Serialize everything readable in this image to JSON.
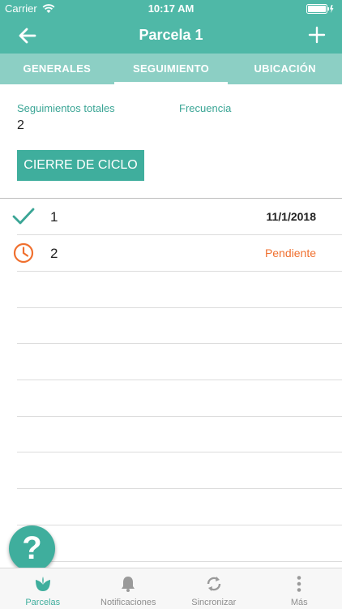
{
  "status_bar": {
    "carrier": "Carrier",
    "time": "10:17 AM"
  },
  "nav": {
    "title": "Parcela 1",
    "back_icon": "arrow-left-icon",
    "add_icon": "plus-icon"
  },
  "tabs": [
    {
      "label": "GENERALES",
      "active": false
    },
    {
      "label": "SEGUIMIENTO",
      "active": true
    },
    {
      "label": "UBICACIÓN",
      "active": false
    }
  ],
  "summary": {
    "total_label": "Seguimientos totales",
    "total_value": "2",
    "frequency_label": "Frecuencia",
    "frequency_value": ""
  },
  "close_cycle_button": "CIERRE DE CICLO",
  "list": [
    {
      "number": "1",
      "status_text": "11/1/2018",
      "icon": "check-icon"
    },
    {
      "number": "2",
      "status_text": "Pendiente",
      "icon": "clock-icon"
    }
  ],
  "help_button": "?",
  "tab_bar": [
    {
      "label": "Parcelas",
      "icon": "leaf-icon",
      "active": true
    },
    {
      "label": "Notificaciones",
      "icon": "bell-icon",
      "active": false
    },
    {
      "label": "Sincronizar",
      "icon": "sync-icon",
      "active": false
    },
    {
      "label": "Más",
      "icon": "more-icon",
      "active": false
    }
  ],
  "colors": {
    "primary": "#4fb8a7",
    "tab_bg": "#8ccfc4",
    "accent": "#3fae9d",
    "pending": "#f0702f"
  }
}
